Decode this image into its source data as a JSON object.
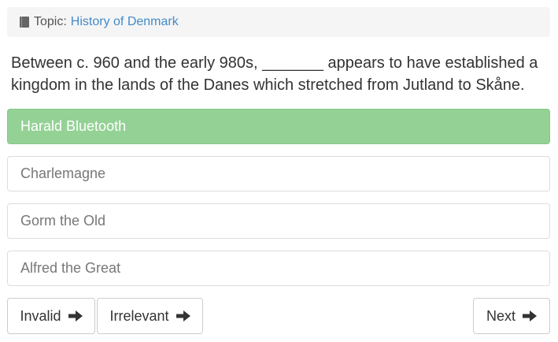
{
  "topic": {
    "label": "Topic:",
    "value": "History of Denmark",
    "icon": "book-icon"
  },
  "question": {
    "text": "Between c. 960 and the early 980s, _______ appears to have established a kingdom in the lands of the Danes which stretched from Jutland to Skåne."
  },
  "answers": [
    {
      "label": "Harald Bluetooth",
      "state": "correct"
    },
    {
      "label": "Charlemagne",
      "state": "default"
    },
    {
      "label": "Gorm the Old",
      "state": "default"
    },
    {
      "label": "Alfred the Great",
      "state": "default"
    }
  ],
  "buttons": {
    "invalid": "Invalid",
    "irrelevant": "Irrelevant",
    "next": "Next"
  },
  "colors": {
    "correct_bg": "#94d195",
    "link": "#428bca",
    "topic_bg": "#f5f5f5"
  }
}
